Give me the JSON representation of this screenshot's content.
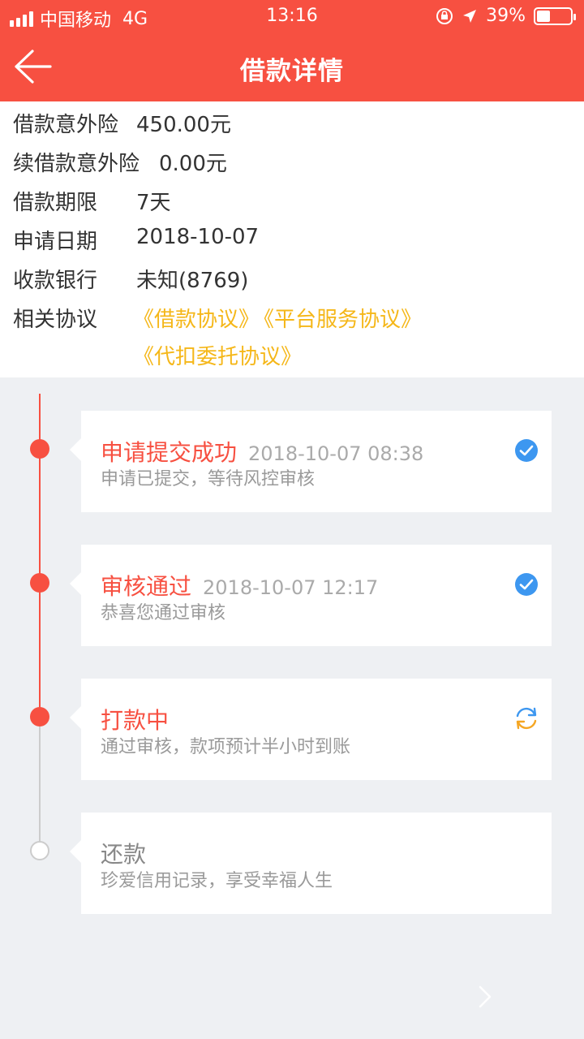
{
  "status_bar": {
    "carrier": "中国移动",
    "network": "4G",
    "time": "13:16",
    "battery": "39%",
    "battery_level": 0.39
  },
  "nav": {
    "title": "借款详情",
    "back_icon": "back-arrow-icon"
  },
  "info": {
    "rows": [
      {
        "label": "借款意外险",
        "value": "450.00元"
      },
      {
        "label": "续借款意外险",
        "value": "0.00元"
      },
      {
        "label": "借款期限",
        "value": "7天"
      },
      {
        "label": "申请日期",
        "value": "2018-10-07"
      },
      {
        "label": "收款银行",
        "value": "未知(8769)"
      },
      {
        "label": "相关协议",
        "value": ""
      }
    ],
    "agreements": [
      "《借款协议》",
      "《平台服务协议》",
      "《代扣委托协议》"
    ]
  },
  "timeline": [
    {
      "title": "申请提交成功",
      "time": "2018-10-07 08:38",
      "desc": "申请已提交，等待风控审核",
      "status_icon": "check-circle-icon",
      "done": true
    },
    {
      "title": "审核通过",
      "time": "2018-10-07 12:17",
      "desc": "恭喜您通过审核",
      "status_icon": "check-circle-icon",
      "done": true
    },
    {
      "title": "打款中",
      "time": "",
      "desc": "通过审核，款项预计半小时到账",
      "status_icon": "refresh-icon",
      "done": true
    },
    {
      "title": "还款",
      "time": "",
      "desc": "珍爱信用记录，享受幸福人生",
      "status_icon": "",
      "done": false
    }
  ],
  "colors": {
    "brand": "#f75041",
    "link": "#f5b719",
    "check": "#3d97f0"
  }
}
